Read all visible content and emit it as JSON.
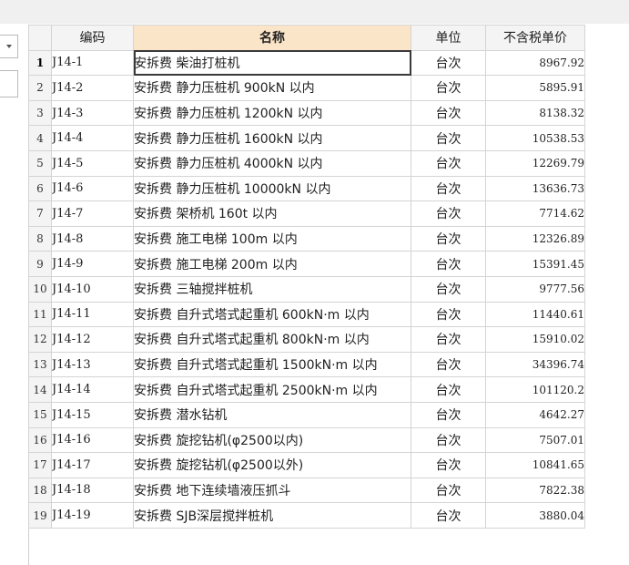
{
  "columns": {
    "code": "编码",
    "name": "名称",
    "unit": "单位",
    "price": "不含税单价"
  },
  "rows": [
    {
      "no": "1",
      "code": "J14-1",
      "name": "安拆费 柴油打桩机",
      "unit": "台次",
      "price": "8967.92"
    },
    {
      "no": "2",
      "code": "J14-2",
      "name": "安拆费 静力压桩机 900kN 以内",
      "unit": "台次",
      "price": "5895.91"
    },
    {
      "no": "3",
      "code": "J14-3",
      "name": "安拆费 静力压桩机 1200kN 以内",
      "unit": "台次",
      "price": "8138.32"
    },
    {
      "no": "4",
      "code": "J14-4",
      "name": "安拆费 静力压桩机 1600kN 以内",
      "unit": "台次",
      "price": "10538.53"
    },
    {
      "no": "5",
      "code": "J14-5",
      "name": "安拆费 静力压桩机 4000kN 以内",
      "unit": "台次",
      "price": "12269.79"
    },
    {
      "no": "6",
      "code": "J14-6",
      "name": "安拆费 静力压桩机 10000kN 以内",
      "unit": "台次",
      "price": "13636.73"
    },
    {
      "no": "7",
      "code": "J14-7",
      "name": "安拆费 架桥机 160t 以内",
      "unit": "台次",
      "price": "7714.62"
    },
    {
      "no": "8",
      "code": "J14-8",
      "name": "安拆费 施工电梯 100m 以内",
      "unit": "台次",
      "price": "12326.89"
    },
    {
      "no": "9",
      "code": "J14-9",
      "name": "安拆费 施工电梯 200m 以内",
      "unit": "台次",
      "price": "15391.45"
    },
    {
      "no": "10",
      "code": "J14-10",
      "name": "安拆费 三轴搅拌桩机",
      "unit": "台次",
      "price": "9777.56"
    },
    {
      "no": "11",
      "code": "J14-11",
      "name": "安拆费 自升式塔式起重机 600kN·m 以内",
      "unit": "台次",
      "price": "11440.61"
    },
    {
      "no": "12",
      "code": "J14-12",
      "name": "安拆费 自升式塔式起重机 800kN·m 以内",
      "unit": "台次",
      "price": "15910.02"
    },
    {
      "no": "13",
      "code": "J14-13",
      "name": "安拆费 自升式塔式起重机 1500kN·m 以内",
      "unit": "台次",
      "price": "34396.74"
    },
    {
      "no": "14",
      "code": "J14-14",
      "name": "安拆费 自升式塔式起重机 2500kN·m 以内",
      "unit": "台次",
      "price": "101120.2"
    },
    {
      "no": "15",
      "code": "J14-15",
      "name": "安拆费 潜水钻机",
      "unit": "台次",
      "price": "4642.27"
    },
    {
      "no": "16",
      "code": "J14-16",
      "name": "安拆费 旋挖钻机(φ2500以内)",
      "unit": "台次",
      "price": "7507.01"
    },
    {
      "no": "17",
      "code": "J14-17",
      "name": "安拆费 旋挖钻机(φ2500以外)",
      "unit": "台次",
      "price": "10841.65"
    },
    {
      "no": "18",
      "code": "J14-18",
      "name": "安拆费 地下连续墙液压抓斗",
      "unit": "台次",
      "price": "7822.38"
    },
    {
      "no": "19",
      "code": "J14-19",
      "name": "安拆费 SJB深层搅拌桩机",
      "unit": "台次",
      "price": "3880.04"
    }
  ],
  "selected_row": "1"
}
